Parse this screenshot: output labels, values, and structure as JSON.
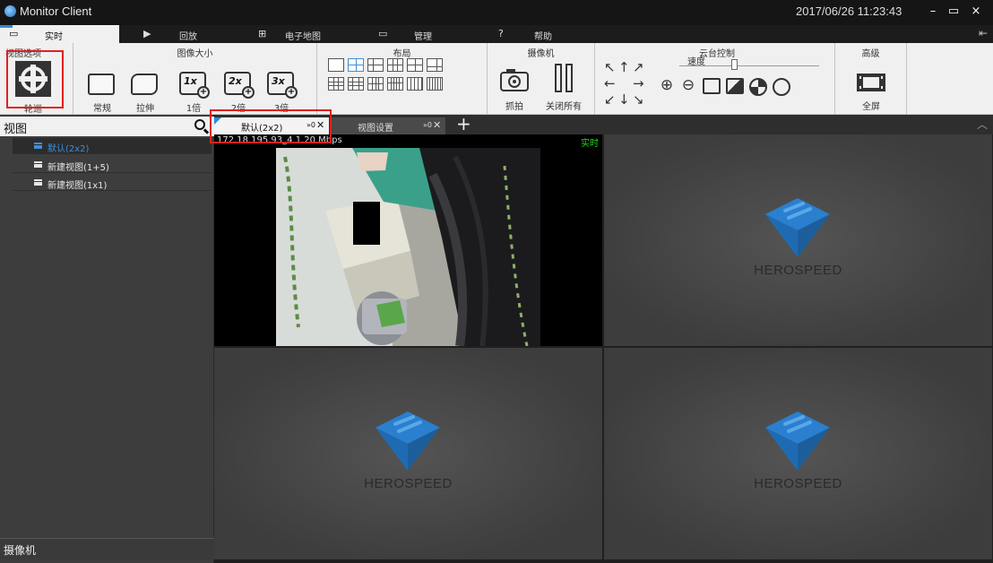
{
  "window": {
    "title": "Monitor Client",
    "datetime": "2017/06/26 11:23:43",
    "controls": {
      "minimize": "–",
      "maximize": "▭",
      "close": "×"
    }
  },
  "nav_tabs": [
    {
      "label": "实时",
      "icon": "monitor-icon",
      "active": true
    },
    {
      "label": "回放",
      "icon": "play-icon",
      "active": false
    },
    {
      "label": "电子地图",
      "icon": "map-icon",
      "active": false
    },
    {
      "label": "管理",
      "icon": "folder-icon",
      "active": false
    },
    {
      "label": "帮助",
      "icon": "help-icon",
      "active": false
    }
  ],
  "toolbar": {
    "view_options": {
      "title": "视图选项",
      "patrol_label": "轮巡"
    },
    "image_size": {
      "title": "图像大小",
      "buttons": [
        {
          "label": "常规"
        },
        {
          "label": "拉伸"
        },
        {
          "label": "1倍",
          "glyph": "1x"
        },
        {
          "label": "2倍",
          "glyph": "2x"
        },
        {
          "label": "3倍",
          "glyph": "3x"
        }
      ]
    },
    "layout": {
      "title": "布局"
    },
    "camera": {
      "title": "摄像机",
      "snapshot_label": "抓拍",
      "close_all_label": "关闭所有"
    },
    "ptz": {
      "title": "云台控制",
      "speed_label": "速度",
      "arrows": [
        "↖",
        "↑",
        "↗",
        "←",
        "→",
        "↙",
        "↓",
        "↘"
      ]
    },
    "advanced": {
      "title": "高级",
      "fullscreen_label": "全屏"
    }
  },
  "sidebar": {
    "header": "视图",
    "views": [
      {
        "label": "默认(2x2)",
        "selected": true
      },
      {
        "label": "新建视图(1+5)",
        "selected": false
      },
      {
        "label": "新建视图(1x1)",
        "selected": false
      }
    ],
    "footer": "摄像机"
  },
  "view_tabs": [
    {
      "label": "默认(2x2)",
      "pin": "»0",
      "close": "✕",
      "active": true
    },
    {
      "label": "视图设置",
      "pin": "»0",
      "close": "✕",
      "active": false
    }
  ],
  "add_tab": "+",
  "video": {
    "pane1_info": "172.18.195.93_4    1.20 Mbps",
    "pane1_status": "实时",
    "logo_text": "HEROSPEED"
  },
  "colors": {
    "accent": "#2b8be0",
    "highlight": "#e02020",
    "live": "#1ddc1d",
    "logo_blue": "#1f7fd0"
  }
}
